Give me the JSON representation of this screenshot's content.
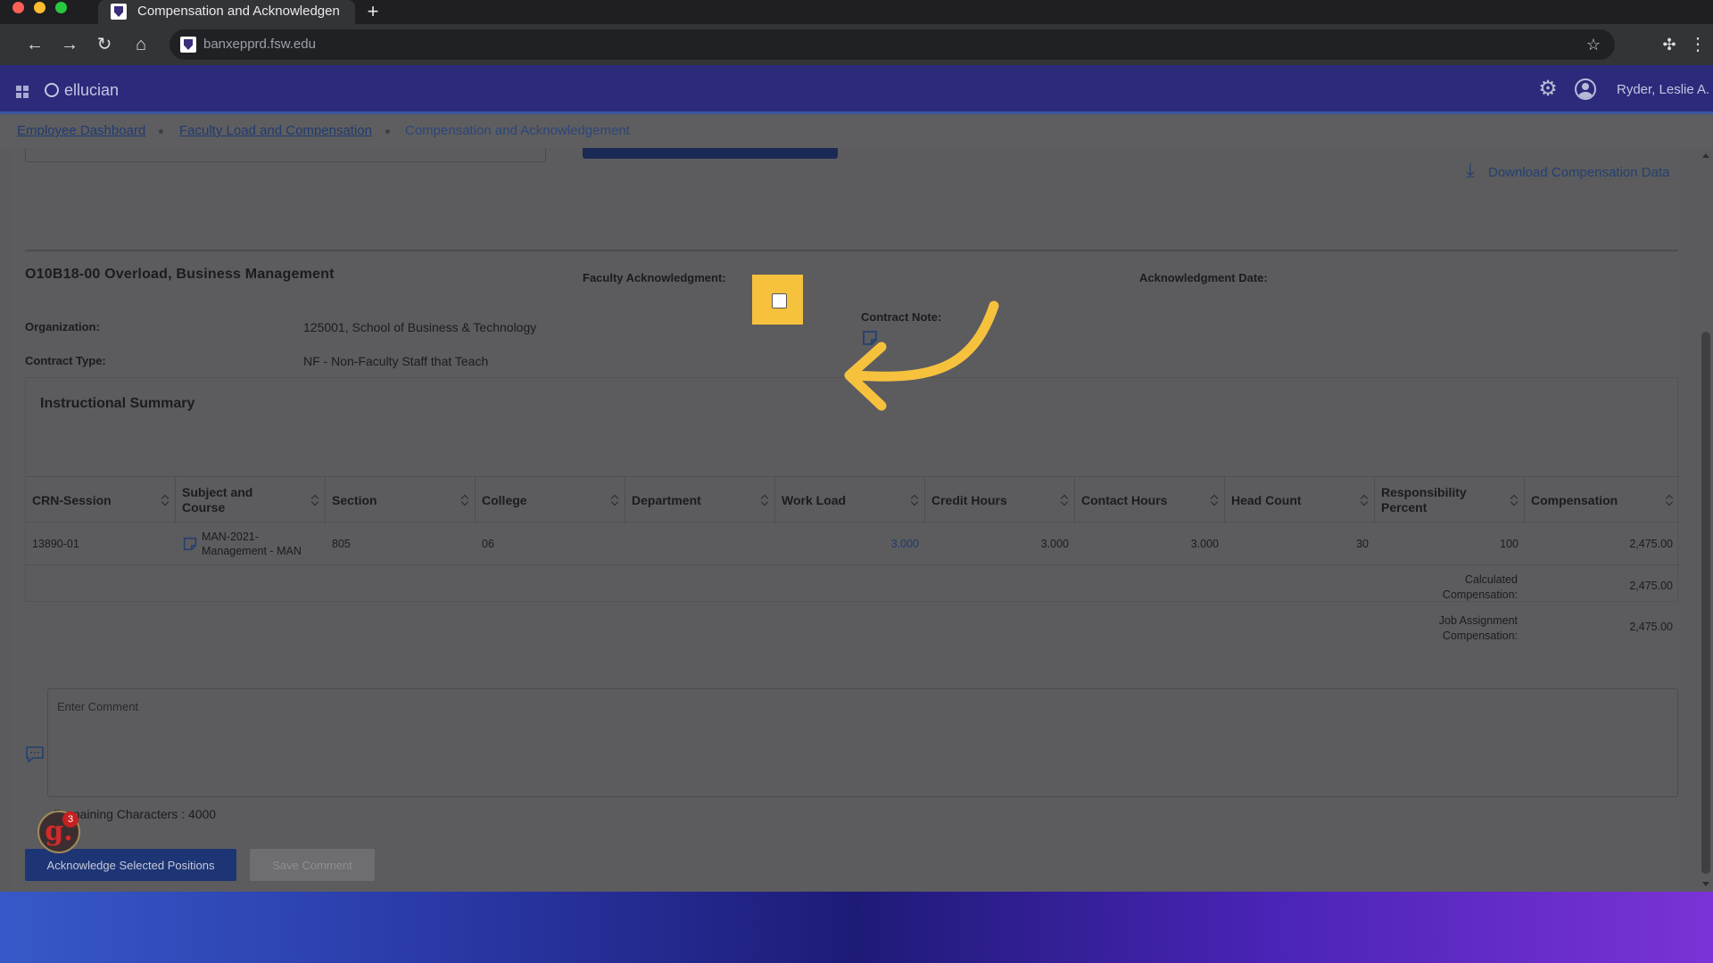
{
  "browser": {
    "tab_title": "Compensation and Acknowledgen",
    "new_tab": "+",
    "url": "banxepprd.fsw.edu",
    "traffic_colors": [
      "#fe5f57",
      "#febc2e",
      "#28c840"
    ]
  },
  "app": {
    "logo_text": "ellucian",
    "username": "Ryder, Leslie A."
  },
  "breadcrumbs": [
    {
      "label": "Employee Dashboard"
    },
    {
      "label": "Faculty Load and Compensation"
    },
    {
      "label": "Compensation and Acknowledgement"
    }
  ],
  "actions": {
    "download_label": "Download Compensation Data"
  },
  "position": {
    "title": "O10B18-00 Overload, Business Management",
    "ack_label": "Faculty Acknowledgment:",
    "ack_checked": false,
    "ack_date_label": "Acknowledgment Date:",
    "organization_label": "Organization:",
    "organization_value": "125001, School of Business & Technology",
    "contract_type_label": "Contract Type:",
    "contract_type_value": "NF - Non-Faculty Staff that Teach",
    "contract_note_label": "Contract Note:"
  },
  "summary": {
    "title": "Instructional Summary",
    "columns": [
      "CRN-Session",
      "Subject and Course",
      "Section",
      "College",
      "Department",
      "Work Load",
      "Credit Hours",
      "Contact Hours",
      "Head Count",
      "Responsibility Percent",
      "Compensation"
    ],
    "row": {
      "crn": "13890-01",
      "course": "MAN-2021-Management - MAN",
      "section": "805",
      "college": "06",
      "department": "",
      "work_load": "3.000",
      "credit_hours": "3.000",
      "contact_hours": "3.000",
      "head_count": "30",
      "responsibility": "100",
      "compensation": "2,475.00"
    },
    "totals": [
      {
        "label": "Calculated Compensation:",
        "value": "2,475.00"
      },
      {
        "label": "Job Assignment Compensation:",
        "value": "2,475.00"
      }
    ]
  },
  "comment": {
    "placeholder": "Enter Comment",
    "remaining": "Remaining Characters : 4000"
  },
  "buttons": {
    "acknowledge": "Acknowledge Selected Positions",
    "save_comment": "Save Comment"
  },
  "guide_badge": {
    "letter": "g.",
    "count": "3"
  },
  "colors": {
    "highlight": "#f6c23e",
    "app_header": "#2c2a7a",
    "primary_button": "#1e3575"
  }
}
